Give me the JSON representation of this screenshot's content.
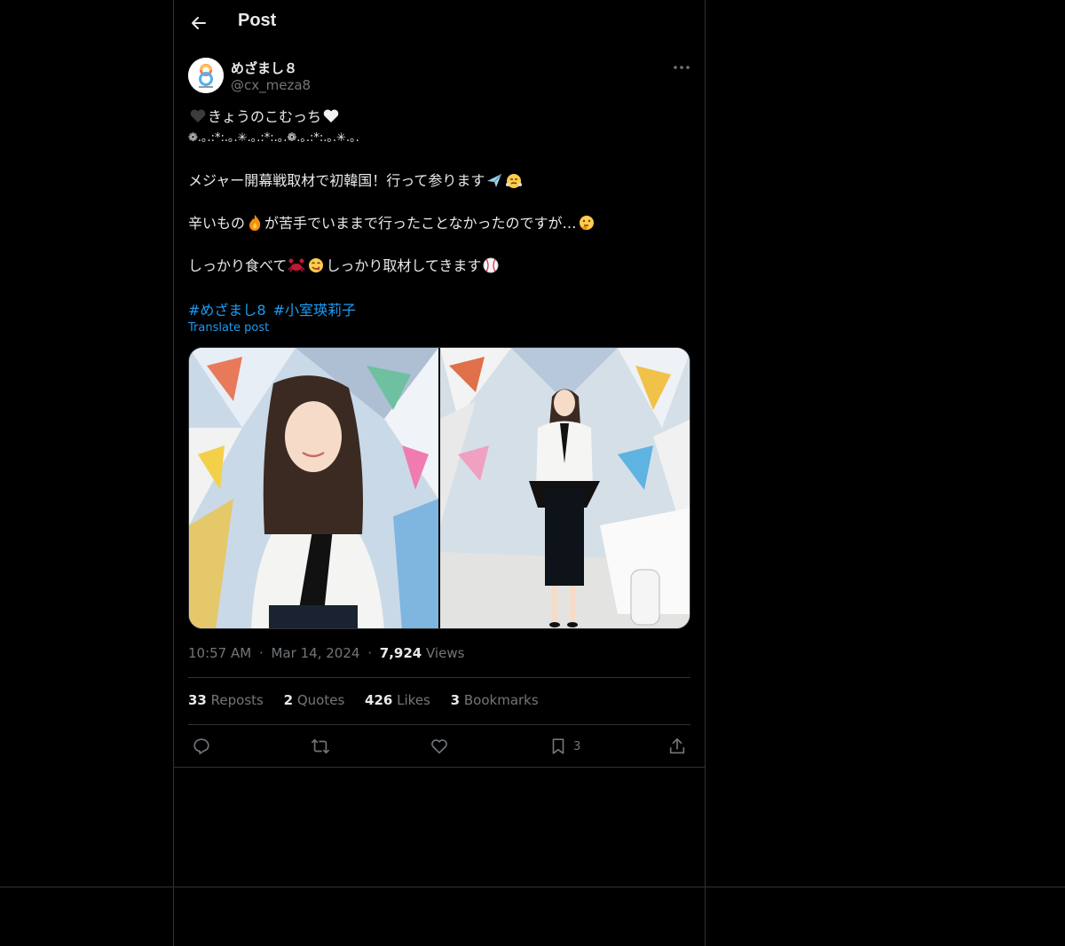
{
  "header": {
    "title": "Post",
    "back_icon": "arrow-left-icon"
  },
  "author": {
    "name": "めざまし８",
    "handle": "@cx_meza8",
    "avatar_icon": "mezamashi8-logo",
    "avatar_label": "めざまし8"
  },
  "post": {
    "lines": [
      {
        "pre": "",
        "emoji1": "black-heart",
        "mid": "きょうのこむっち",
        "emoji2": "white-heart",
        "post": ""
      },
      {
        "pre": "❁.｡.:*:.｡.✳︎.｡.:*:.｡.❁.｡.:*:.｡.✳︎.｡.",
        "emoji1": "",
        "mid": "",
        "emoji2": "",
        "post": ""
      },
      {
        "pre": "",
        "emoji1": "",
        "mid": "",
        "emoji2": "",
        "post": ""
      },
      {
        "pre": "メジャー開幕戦取材で初韓国！行って参ります",
        "emoji1": "airplane",
        "mid": "",
        "emoji2": "triumph-face",
        "post": ""
      },
      {
        "pre": "",
        "emoji1": "",
        "mid": "",
        "emoji2": "",
        "post": ""
      },
      {
        "pre": "辛いもの",
        "emoji1": "fire",
        "mid": "が苦手でいままで行ったことなかったのですが…",
        "emoji2": "thinking-face",
        "post": ""
      },
      {
        "pre": "",
        "emoji1": "",
        "mid": "",
        "emoji2": "",
        "post": ""
      },
      {
        "pre": "しっかり食べて",
        "emoji1": "crab",
        "mid": "",
        "emoji2": "yum-face",
        "post": "しっかり取材してきます",
        "emoji3": "baseball"
      }
    ],
    "hashtags": [
      "#めざまし8",
      "#小室瑛莉子"
    ],
    "translate": "Translate post"
  },
  "meta": {
    "time": "10:57 AM",
    "date": "Mar 14, 2024",
    "views_count": "7,924",
    "views_label": "Views",
    "sep": "·"
  },
  "stats": [
    {
      "count": "33",
      "label": "Reposts"
    },
    {
      "count": "2",
      "label": "Quotes"
    },
    {
      "count": "426",
      "label": "Likes"
    },
    {
      "count": "3",
      "label": "Bookmarks"
    }
  ],
  "actions": {
    "reply_icon": "reply-icon",
    "repost_icon": "repost-icon",
    "like_icon": "heart-icon",
    "bookmark_icon": "bookmark-icon",
    "bookmark_count": "3",
    "share_icon": "share-icon"
  },
  "colors": {
    "accent": "#1d9bf0",
    "muted": "#71767b",
    "text": "#e7e9ea",
    "border": "#2f3336",
    "bg": "#000000"
  }
}
